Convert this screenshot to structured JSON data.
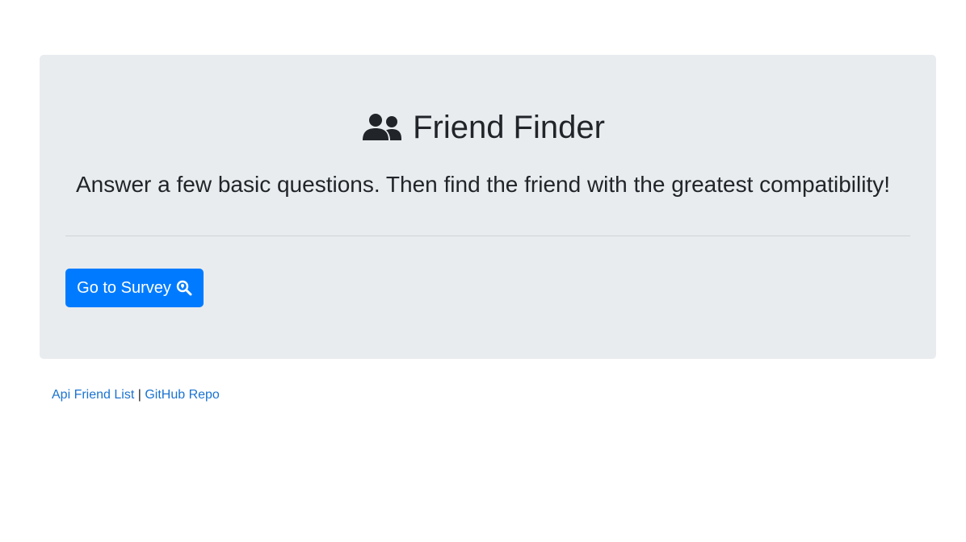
{
  "hero": {
    "title": "Friend Finder",
    "title_icon": "user-friends-icon",
    "lead": "Answer a few basic questions. Then find the friend with the greatest compatibility!",
    "button_label": "Go to Survey",
    "button_icon": "search-location-icon"
  },
  "footer": {
    "link_api": "Api Friend List",
    "separator": "|",
    "link_repo": "GitHub Repo"
  },
  "colors": {
    "jumbotron_bg": "#e9ecef",
    "primary": "#007bff",
    "link": "#1a73d0",
    "text": "#212529"
  }
}
